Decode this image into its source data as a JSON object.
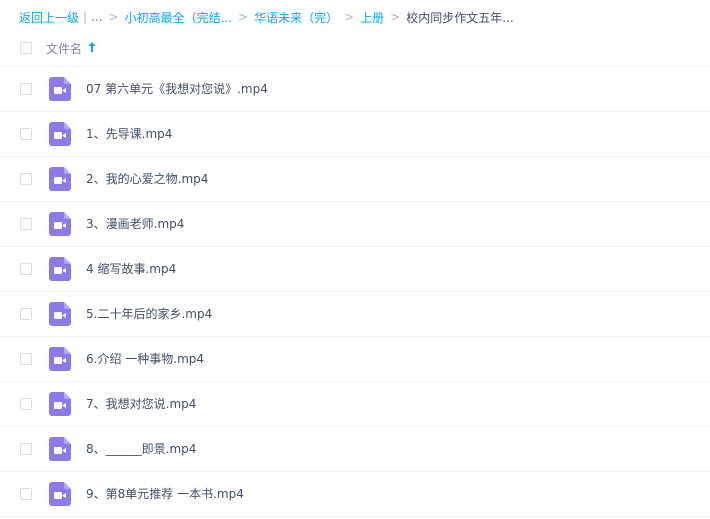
{
  "breadcrumb": {
    "back_label": "返回上一级",
    "separator_bar": "|",
    "ellipsis": "...",
    "sep": ">",
    "crumbs": [
      "小初高最全（完结...",
      "华语未来（完）",
      "上册"
    ],
    "current": "校内同步作文五年..."
  },
  "header": {
    "name_label": "文件名"
  },
  "colors": {
    "accent": "#06a7ff",
    "video_icon": "#8a7be8",
    "text": "#424e67"
  },
  "files": [
    {
      "name": "07 第六单元《我想对您说》.mp4",
      "icon": "video-file-icon"
    },
    {
      "name": "1、先导课.mp4",
      "icon": "video-file-icon"
    },
    {
      "name": "2、我的心爱之物.mp4",
      "icon": "video-file-icon"
    },
    {
      "name": "3、漫画老师.mp4",
      "icon": "video-file-icon"
    },
    {
      "name": "4 缩写故事.mp4",
      "icon": "video-file-icon"
    },
    {
      "name": "5.二十年后的家乡.mp4",
      "icon": "video-file-icon"
    },
    {
      "name": "6.介绍 一种事物.mp4",
      "icon": "video-file-icon"
    },
    {
      "name": "7、我想对您说.mp4",
      "icon": "video-file-icon"
    },
    {
      "name": "8、______即景.mp4",
      "icon": "video-file-icon"
    },
    {
      "name": "9、第8单元推荐 一本书.mp4",
      "icon": "video-file-icon"
    }
  ]
}
